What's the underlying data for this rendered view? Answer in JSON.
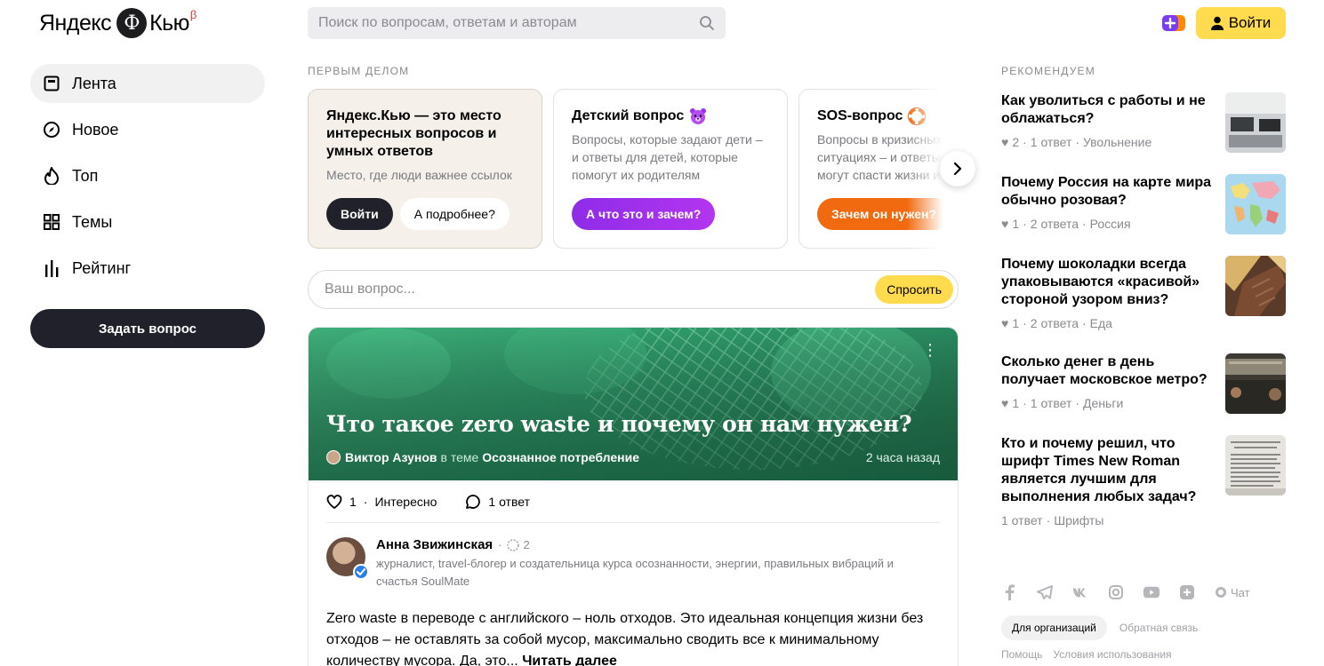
{
  "header": {
    "logo_text": "Яндекс",
    "logo_letter": "Ф",
    "logo_product": "Кью",
    "logo_beta": "β",
    "search_placeholder": "Поиск по вопросам, ответам и авторам",
    "login_label": "Войти"
  },
  "sidebar": {
    "items": [
      {
        "label": "Лента",
        "icon": "feed-icon",
        "active": true
      },
      {
        "label": "Новое",
        "icon": "compass-icon"
      },
      {
        "label": "Топ",
        "icon": "fire-icon"
      },
      {
        "label": "Темы",
        "icon": "grid-icon"
      },
      {
        "label": "Рейтинг",
        "icon": "rating-icon"
      }
    ],
    "ask_button": "Задать вопрос"
  },
  "first": {
    "label": "ПЕРВЫМ ДЕЛОМ",
    "cards": [
      {
        "title": "Яндекс.Кью — это место интересных вопросов и умных ответов",
        "text": "Место, где люди важнее ссылок",
        "btn1": "Войти",
        "btn2": "А подробнее?"
      },
      {
        "title": "Детский вопрос",
        "emoji": "🐻",
        "text": "Вопросы, которые задают дети – и ответы для детей, которые помогут их родителям",
        "btn": "А что это и зачем?"
      },
      {
        "title": "SOS-вопрос",
        "text": "Вопросы в кризисных и сложных ситуациях – и ответы, которые могут спасти жизни и здоровье",
        "btn": "Зачем он нужен?"
      }
    ]
  },
  "ask_box": {
    "placeholder": "Ваш вопрос...",
    "submit": "Спросить"
  },
  "feed": {
    "title": "Что такое zero waste и почему он нам нужен?",
    "author": "Виктор Азунов",
    "in_topic": "в теме",
    "topic": "Осознанное потребление",
    "time": "2 часа назад",
    "likes": "1",
    "likes_label": "Интересно",
    "answers": "1 ответ",
    "answer": {
      "name": "Анна Звижинская",
      "rank": "2",
      "bio": "журналист, travel-блогер и создательница курса осознанности, энергии, правильных вибраций и счастья SoulMate",
      "text": "Zero waste в переводе с английского – ноль отходов. Это идеальная концепция жизни без отходов – не оставлять за собой мусор, максимально сводить все к минимальному количеству мусора. Да, это... ",
      "more": "Читать далее"
    }
  },
  "recommend": {
    "label": "РЕКОМЕНДУЕМ",
    "items": [
      {
        "title": "Как уволиться с работы и не облажаться?",
        "likes": "2",
        "answers": "1 ответ",
        "topic": "Увольнение"
      },
      {
        "title": "Почему Россия на карте мира обычно розовая?",
        "likes": "1",
        "answers": "2 ответа",
        "topic": "Россия"
      },
      {
        "title": "Почему шоколадки всегда упаковываются «красивой» стороной узором вниз?",
        "likes": "1",
        "answers": "2 ответа",
        "topic": "Еда"
      },
      {
        "title": "Сколько денег в день получает московское метро?",
        "likes": "1",
        "answers": "1 ответ",
        "topic": "Деньги"
      },
      {
        "title": "Кто и почему решил, что шрифт Times New Roman является лучшим для выполнения любых задач?",
        "answers": "1 ответ",
        "topic": "Шрифты"
      }
    ]
  },
  "footer": {
    "chat": "Чат",
    "org": "Для организаций",
    "feedback": "Обратная связь",
    "help": "Помощь",
    "terms": "Условия использования"
  },
  "colors": {
    "accent_yellow": "#ffdb4d",
    "dark": "#21212b",
    "purple": "#9b30ec",
    "orange": "#f26a0f",
    "hero_green": "#2f9a6a"
  }
}
